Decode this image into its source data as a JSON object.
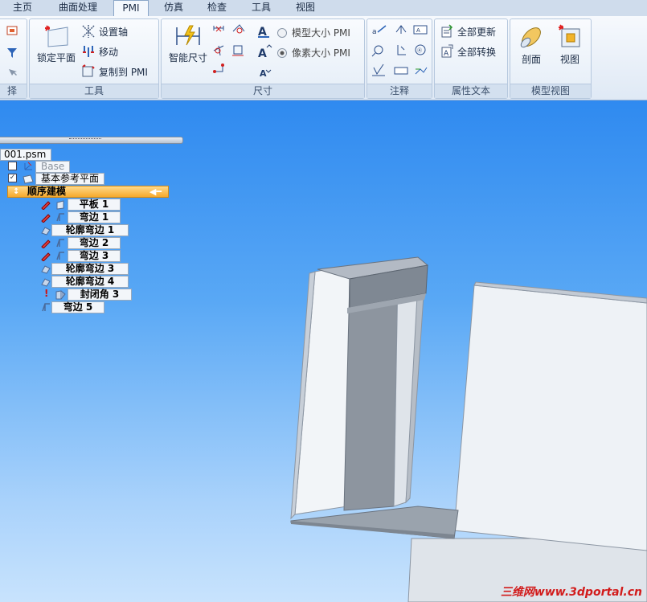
{
  "tabs": [
    "主页",
    "曲面处理",
    "PMI",
    "仿真",
    "检查",
    "工具",
    "视图"
  ],
  "active_tab": "PMI",
  "groups": {
    "left_partial": {
      "label": "择"
    },
    "tools": {
      "label": "工具",
      "lock_plane": "锁定平面",
      "set_axis": "设置轴",
      "move": "移动",
      "copy_to_pmi": "复制到 PMI"
    },
    "dimension": {
      "label": "尺寸",
      "smart_dim": "智能尺寸",
      "model_size": "模型大小 PMI",
      "pixel_size": "像素大小 PMI",
      "pixel_size_selected": true
    },
    "annotation": {
      "label": "注释"
    },
    "property_text": {
      "label": "属性文本",
      "update_all": "全部更新",
      "convert_all": "全部转换"
    },
    "model_view": {
      "label": "模型视图",
      "section": "剖面",
      "view": "视图"
    }
  },
  "tree": {
    "file": "001.psm",
    "items": [
      {
        "label": "Base",
        "checked": false,
        "dim": true
      },
      {
        "label": "基本参考平面",
        "checked": true
      },
      {
        "label": "顺序建模",
        "selected": true
      },
      {
        "label": "平板 1"
      },
      {
        "label": "弯边 1"
      },
      {
        "label": "轮廓弯边 1"
      },
      {
        "label": "弯边 2"
      },
      {
        "label": "弯边 3"
      },
      {
        "label": "轮廓弯边 3"
      },
      {
        "label": "轮廓弯边 4"
      },
      {
        "label": "封闭角 3",
        "warning": true
      },
      {
        "label": "弯边 5"
      }
    ]
  },
  "watermark": "三维网www.3dportal.cn",
  "colors": {
    "accent": "#f6a92b",
    "viewport_top": "#2f8af0",
    "watermark": "#d21b1b"
  }
}
